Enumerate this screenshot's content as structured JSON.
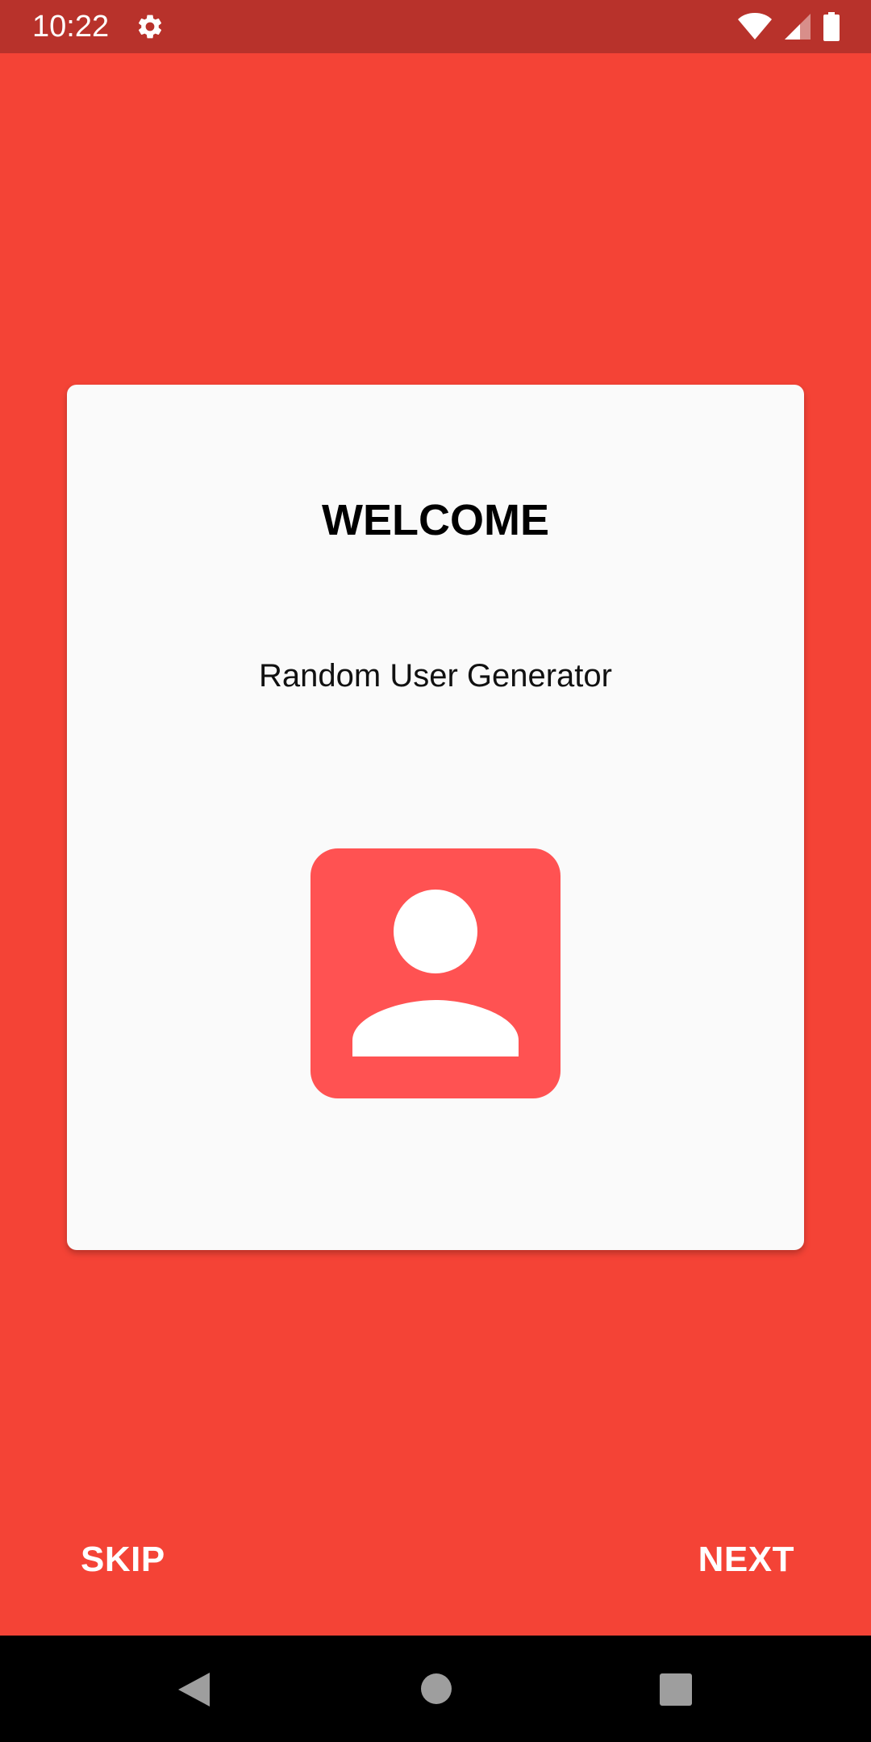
{
  "status_bar": {
    "time": "10:22",
    "icons": [
      "settings-gear-icon",
      "wifi-icon",
      "cellular-signal-icon",
      "battery-icon"
    ]
  },
  "card": {
    "title": "WELCOME",
    "subtitle": "Random User Generator",
    "illustration_icon": "account-box-icon"
  },
  "actions": {
    "skip_label": "SKIP",
    "next_label": "NEXT"
  },
  "navigation_bar": {
    "icons": [
      "back-triangle-icon",
      "home-circle-icon",
      "recents-square-icon"
    ]
  },
  "colors": {
    "background": "#F44336",
    "status_bar": "#B8322B",
    "card": "#FAFAFA",
    "icon_tile": "#FF5252",
    "nav_bar": "#000000"
  }
}
